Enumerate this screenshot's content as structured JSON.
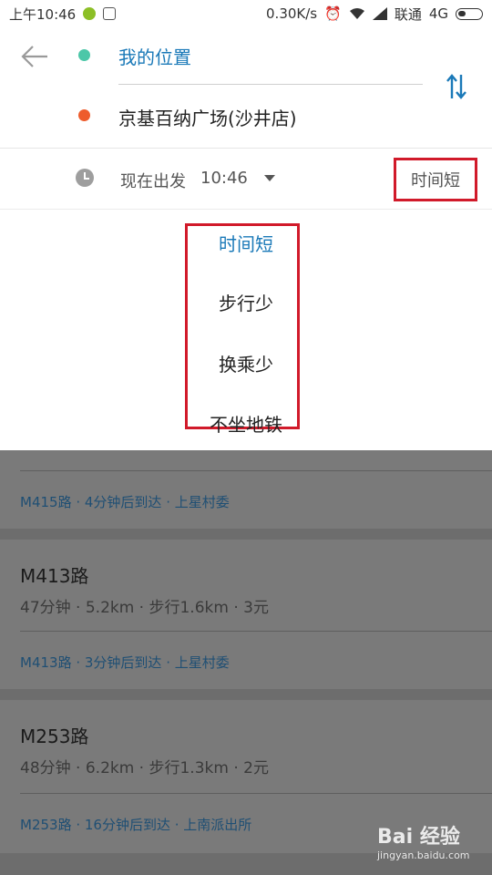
{
  "status_bar": {
    "time": "上午10:46",
    "net_speed": "0.30K/s",
    "carrier": "联通",
    "network": "4G",
    "icons": [
      "notification-icon",
      "image-icon",
      "alarm-icon",
      "wifi-icon",
      "signal-icon",
      "battery-icon"
    ]
  },
  "route": {
    "start": "我的位置",
    "end": "京基百纳广场(沙井店)",
    "start_color": "#4cc7a8",
    "end_color": "#ee5c2c",
    "link_color": "#1a79b8"
  },
  "time_row": {
    "depart_label": "现在出发",
    "depart_time": "10:46",
    "sort_label": "时间短"
  },
  "sort_menu": {
    "items": [
      "时间短",
      "步行少",
      "换乘少",
      "不坐地铁"
    ],
    "selected": "时间短"
  },
  "results": [
    {
      "realtime": "M415路 · 4分钟后到达 · 上星村委"
    },
    {
      "title": "M413路",
      "meta": "47分钟 · 5.2km · 步行1.6km · 3元",
      "realtime": "M413路 · 3分钟后到达 · 上星村委"
    },
    {
      "title": "M253路",
      "meta": "48分钟 · 6.2km · 步行1.3km · 2元",
      "realtime": "M253路 · 16分钟后到达 · 上南派出所"
    }
  ],
  "watermark": {
    "brand": "Bai 经验",
    "url": "jingyan.baidu.com"
  }
}
